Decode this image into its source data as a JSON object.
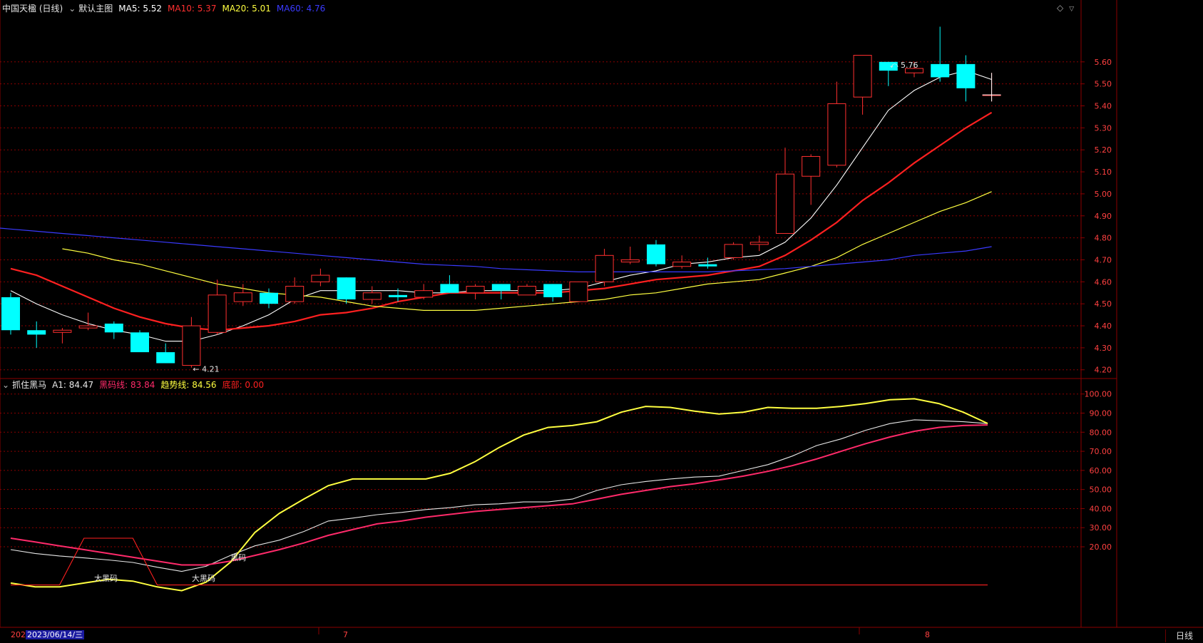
{
  "header": {
    "stock_name": "中国天楹 (日线)",
    "menu_label": "默认主图",
    "ma": [
      {
        "label": "MA5:",
        "value": "5.52",
        "color": "#ffffff"
      },
      {
        "label": "MA10:",
        "value": "5.37",
        "color": "#ff3030"
      },
      {
        "label": "MA20:",
        "value": "5.01",
        "color": "#ffff40"
      },
      {
        "label": "MA60:",
        "value": "4.76",
        "color": "#3a3aff"
      }
    ]
  },
  "indicator_header": {
    "name": "抓住黑马",
    "items": [
      {
        "label": "A1:",
        "value": "84.47",
        "color": "#e8e8e8"
      },
      {
        "label": "黑码线:",
        "value": "83.84",
        "color": "#ff2a6a"
      },
      {
        "label": "趋势线:",
        "value": "84.56",
        "color": "#ffff40"
      },
      {
        "label": "底部:",
        "value": "0.00",
        "color": "#ff2020"
      }
    ]
  },
  "bottom_bar": {
    "date_prefix": "202",
    "date_label": "2023/06/14/三",
    "month_marks": [
      {
        "label": "7"
      },
      {
        "label": "8"
      }
    ],
    "period_button": "日线"
  },
  "colors": {
    "up": "#ff3030",
    "down": "#00ffff",
    "ma5": "#ffffff",
    "ma10": "#ff2020",
    "ma20": "#ffff40",
    "ma60": "#3a3aff",
    "grid": "#8b0000",
    "axis_text": "#ff4040"
  },
  "chart_data": [
    {
      "type": "candlestick",
      "title": "中国天楹 (日线)",
      "ylim": [
        4.17,
        5.81
      ],
      "y_ticks": [
        4.2,
        4.3,
        4.4,
        4.5,
        4.6,
        4.7,
        4.8,
        4.9,
        5.0,
        5.1,
        5.2,
        5.3,
        5.4,
        5.5,
        5.6
      ],
      "grid": true,
      "annotations": [
        {
          "label": "5.76",
          "candle": 34
        },
        {
          "label": "4.21",
          "candle": 7
        }
      ],
      "candles": [
        {
          "o": 4.53,
          "h": 4.55,
          "l": 4.36,
          "c": 4.38
        },
        {
          "o": 4.38,
          "h": 4.42,
          "l": 4.3,
          "c": 4.36
        },
        {
          "o": 4.37,
          "h": 4.39,
          "l": 4.32,
          "c": 4.38
        },
        {
          "o": 4.39,
          "h": 4.46,
          "l": 4.38,
          "c": 4.4
        },
        {
          "o": 4.41,
          "h": 4.42,
          "l": 4.34,
          "c": 4.37
        },
        {
          "o": 4.37,
          "h": 4.38,
          "l": 4.28,
          "c": 4.28
        },
        {
          "o": 4.28,
          "h": 4.32,
          "l": 4.23,
          "c": 4.23
        },
        {
          "o": 4.22,
          "h": 4.44,
          "l": 4.21,
          "c": 4.4
        },
        {
          "o": 4.37,
          "h": 4.61,
          "l": 4.36,
          "c": 4.54
        },
        {
          "o": 4.51,
          "h": 4.59,
          "l": 4.49,
          "c": 4.55
        },
        {
          "o": 4.55,
          "h": 4.57,
          "l": 4.48,
          "c": 4.5
        },
        {
          "o": 4.51,
          "h": 4.62,
          "l": 4.5,
          "c": 4.58
        },
        {
          "o": 4.6,
          "h": 4.66,
          "l": 4.58,
          "c": 4.63
        },
        {
          "o": 4.62,
          "h": 4.62,
          "l": 4.5,
          "c": 4.52
        },
        {
          "o": 4.52,
          "h": 4.58,
          "l": 4.5,
          "c": 4.55
        },
        {
          "o": 4.54,
          "h": 4.57,
          "l": 4.51,
          "c": 4.53
        },
        {
          "o": 4.53,
          "h": 4.59,
          "l": 4.52,
          "c": 4.56
        },
        {
          "o": 4.59,
          "h": 4.63,
          "l": 4.55,
          "c": 4.55
        },
        {
          "o": 4.55,
          "h": 4.59,
          "l": 4.52,
          "c": 4.58
        },
        {
          "o": 4.59,
          "h": 4.59,
          "l": 4.52,
          "c": 4.56
        },
        {
          "o": 4.54,
          "h": 4.59,
          "l": 4.54,
          "c": 4.58
        },
        {
          "o": 4.59,
          "h": 4.59,
          "l": 4.51,
          "c": 4.53
        },
        {
          "o": 4.51,
          "h": 4.6,
          "l": 4.51,
          "c": 4.6
        },
        {
          "o": 4.6,
          "h": 4.75,
          "l": 4.58,
          "c": 4.72
        },
        {
          "o": 4.69,
          "h": 4.76,
          "l": 4.68,
          "c": 4.7
        },
        {
          "o": 4.77,
          "h": 4.79,
          "l": 4.67,
          "c": 4.68
        },
        {
          "o": 4.67,
          "h": 4.72,
          "l": 4.66,
          "c": 4.69
        },
        {
          "o": 4.68,
          "h": 4.71,
          "l": 4.66,
          "c": 4.67
        },
        {
          "o": 4.71,
          "h": 4.78,
          "l": 4.7,
          "c": 4.77
        },
        {
          "o": 4.77,
          "h": 4.81,
          "l": 4.74,
          "c": 4.78
        },
        {
          "o": 4.82,
          "h": 5.21,
          "l": 4.82,
          "c": 5.09
        },
        {
          "o": 5.08,
          "h": 5.18,
          "l": 4.95,
          "c": 5.17
        },
        {
          "o": 5.13,
          "h": 5.51,
          "l": 5.12,
          "c": 5.41
        },
        {
          "o": 5.44,
          "h": 5.63,
          "l": 5.36,
          "c": 5.63
        },
        {
          "o": 5.6,
          "h": 5.6,
          "l": 5.49,
          "c": 5.56
        },
        {
          "o": 5.55,
          "h": 5.6,
          "l": 5.53,
          "c": 5.57
        },
        {
          "o": 5.59,
          "h": 5.76,
          "l": 5.51,
          "c": 5.53
        },
        {
          "o": 5.59,
          "h": 5.63,
          "l": 5.42,
          "c": 5.48
        },
        {
          "o": 5.45,
          "h": 5.55,
          "l": 5.42,
          "c": 5.45
        }
      ],
      "series": [
        {
          "name": "MA5",
          "values": [
            4.56,
            4.5,
            4.45,
            4.41,
            4.38,
            4.36,
            4.33,
            4.33,
            4.36,
            4.4,
            4.45,
            4.52,
            4.56,
            4.56,
            4.56,
            4.56,
            4.55,
            4.55,
            4.56,
            4.56,
            4.56,
            4.56,
            4.57,
            4.6,
            4.63,
            4.65,
            4.68,
            4.69,
            4.71,
            4.72,
            4.78,
            4.89,
            5.04,
            5.21,
            5.38,
            5.47,
            5.53,
            5.56,
            5.52
          ]
        },
        {
          "name": "MA10",
          "values": [
            4.66,
            4.63,
            4.58,
            4.53,
            4.48,
            4.44,
            4.41,
            4.39,
            4.38,
            4.39,
            4.4,
            4.42,
            4.45,
            4.46,
            4.48,
            4.51,
            4.53,
            4.55,
            4.55,
            4.55,
            4.55,
            4.55,
            4.56,
            4.57,
            4.59,
            4.61,
            4.62,
            4.63,
            4.65,
            4.67,
            4.72,
            4.79,
            4.87,
            4.97,
            5.05,
            5.14,
            5.22,
            5.3,
            5.37
          ]
        },
        {
          "name": "MA20",
          "values": [
            4.75,
            4.73,
            4.7,
            4.68,
            4.65,
            4.62,
            4.59,
            4.57,
            4.55,
            4.54,
            4.53,
            4.51,
            4.49,
            4.48,
            4.47,
            4.47,
            4.47,
            4.48,
            4.49,
            4.5,
            4.51,
            4.52,
            4.54,
            4.55,
            4.57,
            4.59,
            4.6,
            4.61,
            4.64,
            4.67,
            4.71,
            4.77,
            4.82,
            4.87,
            4.92,
            4.96,
            5.01
          ]
        },
        {
          "name": "MA60",
          "values": [
            4.85,
            4.84,
            4.83,
            4.82,
            4.81,
            4.8,
            4.79,
            4.78,
            4.77,
            4.76,
            4.75,
            4.74,
            4.73,
            4.72,
            4.71,
            4.7,
            4.69,
            4.68,
            4.675,
            4.67,
            4.66,
            4.655,
            4.65,
            4.645,
            4.645,
            4.645,
            4.645,
            4.645,
            4.645,
            4.65,
            4.655,
            4.66,
            4.67,
            4.68,
            4.69,
            4.7,
            4.72,
            4.73,
            4.74,
            4.76
          ]
        }
      ]
    },
    {
      "type": "line",
      "title": "抓住黑马",
      "ylim": [
        -5,
        104
      ],
      "y_ticks": [
        20.0,
        30.0,
        40.0,
        50.0,
        60.0,
        70.0,
        80.0,
        90.0,
        100.0
      ],
      "grid": true,
      "annotations": [
        {
          "label": "大黑码",
          "candle": 4
        },
        {
          "label": "大黑码",
          "candle": 8
        },
        {
          "label": "黑码",
          "candle": 9
        }
      ],
      "series": [
        {
          "name": "A1",
          "values": [
            18.5,
            16.5,
            15.2,
            14.2,
            13.1,
            11.8,
            9.3,
            7.1,
            9.8,
            15.5,
            20.5,
            23.5,
            28.0,
            33.5,
            35.0,
            36.8,
            38.0,
            39.5,
            40.5,
            42.0,
            42.5,
            43.5,
            43.5,
            45.0,
            49.5,
            52.5,
            54.2,
            55.5,
            56.5,
            57.0,
            60.0,
            63.0,
            67.5,
            73.0,
            76.5,
            81.0,
            84.5,
            86.5,
            86.0,
            85.5,
            84.5
          ]
        },
        {
          "name": "黑码线",
          "values": [
            24.5,
            22.5,
            20.5,
            18.5,
            16.5,
            14.5,
            12.5,
            10.5,
            10.5,
            12.5,
            15.5,
            18.5,
            22.0,
            26.0,
            29.0,
            32.0,
            33.5,
            35.5,
            37.0,
            38.5,
            39.5,
            40.5,
            41.5,
            42.5,
            45.0,
            47.5,
            49.5,
            51.5,
            53.0,
            55.0,
            57.0,
            59.5,
            62.5,
            66.0,
            70.0,
            74.0,
            77.5,
            80.5,
            82.5,
            83.5,
            83.8
          ]
        },
        {
          "name": "趋势线",
          "values": [
            1.0,
            -1.0,
            -1.0,
            1.0,
            3.0,
            2.0,
            -1.0,
            -3.0,
            1.5,
            12.0,
            27.5,
            37.5,
            45.0,
            52.0,
            55.5,
            55.5,
            55.5,
            55.5,
            58.5,
            64.5,
            72.0,
            78.5,
            82.5,
            83.5,
            85.5,
            90.5,
            93.5,
            93.0,
            91.0,
            89.5,
            90.5,
            93.0,
            92.5,
            92.5,
            93.5,
            95.0,
            97.0,
            97.5,
            95.0,
            90.5,
            84.6
          ]
        },
        {
          "name": "底部",
          "values": [
            0,
            0,
            0,
            24.5,
            24.5,
            24.5,
            0,
            0,
            0,
            0,
            0,
            0,
            0,
            0,
            0,
            0,
            0,
            0,
            0,
            0,
            0,
            0,
            0,
            0,
            0,
            0,
            0,
            0,
            0,
            0,
            0,
            0,
            0,
            0,
            0,
            0,
            0,
            0,
            0,
            0,
            0
          ]
        }
      ]
    }
  ]
}
